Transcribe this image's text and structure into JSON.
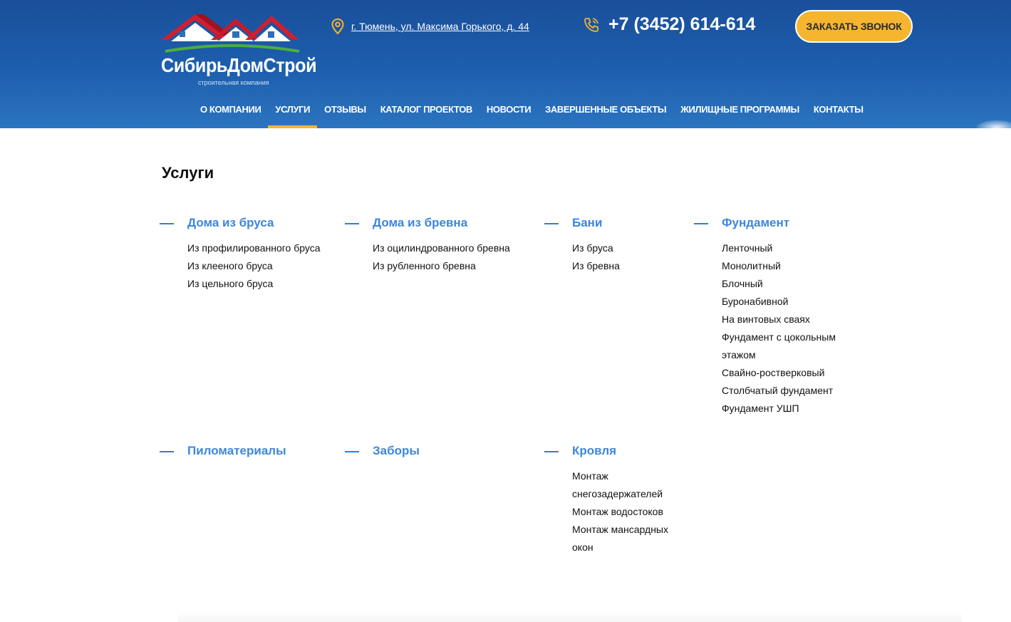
{
  "header": {
    "logo_text": "СибирьДомСтрой",
    "logo_subtitle": "строительная компания",
    "address": "г. Тюмень, ул. Максима Горького, д. 44",
    "phone": "+7 (3452) 614-614",
    "callback_label": "ЗАКАЗАТЬ ЗВОНОК",
    "accent_color": "#f5b52e"
  },
  "nav": {
    "items": [
      {
        "label": "О КОМПАНИИ"
      },
      {
        "label": "УСЛУГИ"
      },
      {
        "label": "ОТЗЫВЫ"
      },
      {
        "label": "КАТАЛОГ ПРОЕКТОВ"
      },
      {
        "label": "НОВОСТИ"
      },
      {
        "label": "ЗАВЕРШЕННЫЕ ОБЪЕКТЫ"
      },
      {
        "label": "ЖИЛИЩНЫЕ ПРОГРАММЫ"
      },
      {
        "label": "КОНТАКТЫ"
      }
    ],
    "active": "УСЛУГИ"
  },
  "page": {
    "title": "Услуги"
  },
  "categories": [
    {
      "title": "Дома из бруса",
      "items": [
        "Из профилированного бруса",
        "Из клееного бруса",
        "Из цельного бруса"
      ]
    },
    {
      "title": "Дома из бревна",
      "items": [
        "Из оцилиндрованного бревна",
        "Из рубленного бревна"
      ]
    },
    {
      "title": "Бани",
      "items": [
        "Из бруса",
        "Из бревна"
      ]
    },
    {
      "title": "Фундамент",
      "items": [
        "Ленточный",
        "Монолитный",
        "Блочный",
        "Буронабивной",
        "На винтовых сваях",
        "Фундамент с цокольным этажом",
        "Свайно-ростверковый",
        "Столбчатый фундамент",
        "Фундамент УШП"
      ]
    },
    {
      "title": "Пиломатериалы",
      "items": []
    },
    {
      "title": "Заборы",
      "items": []
    },
    {
      "title": "Кровля",
      "items": [
        "Монтаж снегозадержателей",
        "Монтаж водостоков",
        "Монтаж мансардных окон"
      ]
    }
  ],
  "colors": {
    "header_blue": "#1d5fae",
    "link_blue": "#3d86dd",
    "dash_blue": "#2f7de0"
  }
}
